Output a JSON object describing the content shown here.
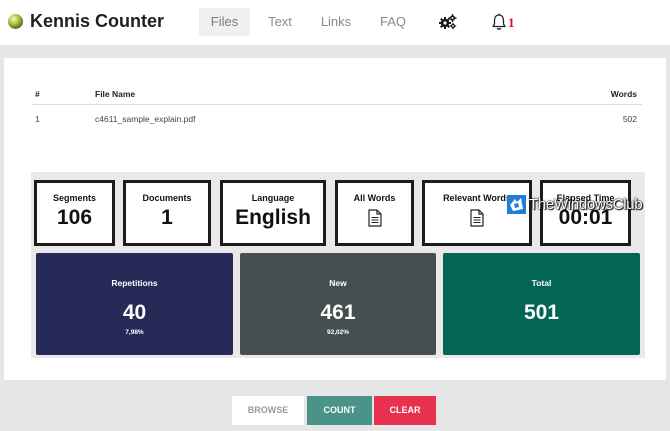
{
  "app": {
    "name": "Kennis Counter"
  },
  "nav": {
    "items": [
      {
        "id": "files",
        "label": "Files",
        "active": true
      },
      {
        "id": "text",
        "label": "Text"
      },
      {
        "id": "links",
        "label": "Links"
      },
      {
        "id": "faq",
        "label": "FAQ"
      }
    ],
    "settings_icon": "gears-icon",
    "notification_icon": "bell-icon",
    "notification_count": "1"
  },
  "file_table": {
    "headers": [
      "#",
      "File Name",
      "Words"
    ],
    "rows": [
      {
        "num": "1",
        "name": "c4611_sample_explain.pdf",
        "words": "502"
      }
    ]
  },
  "stats": {
    "segments": {
      "label": "Segments",
      "value": "106"
    },
    "documents": {
      "label": "Documents",
      "value": "1"
    },
    "language": {
      "label": "Language",
      "value": "English"
    },
    "all_words": {
      "label": "All Words",
      "icon": "document-icon"
    },
    "relevant_words": {
      "label": "Relevant Words",
      "icon": "document-icon"
    },
    "elapsed": {
      "label": "Elapsed Time",
      "value": "00:01"
    }
  },
  "totals": {
    "repetitions": {
      "label": "Repetitions",
      "value": "40",
      "percent": "7,98%",
      "color": "#252a56"
    },
    "new": {
      "label": "New",
      "value": "461",
      "percent": "92,02%",
      "color": "#454f50"
    },
    "total": {
      "label": "Total",
      "value": "501",
      "color": "#036654"
    }
  },
  "watermark": {
    "text": "TheWindowsClub"
  },
  "buttons": {
    "browse": "BROWSE",
    "count": "COUNT",
    "clear": "CLEAR"
  },
  "colors": {
    "accent_count": "#4b9389",
    "accent_clear": "#e8314f",
    "notification": "#d0102a"
  }
}
